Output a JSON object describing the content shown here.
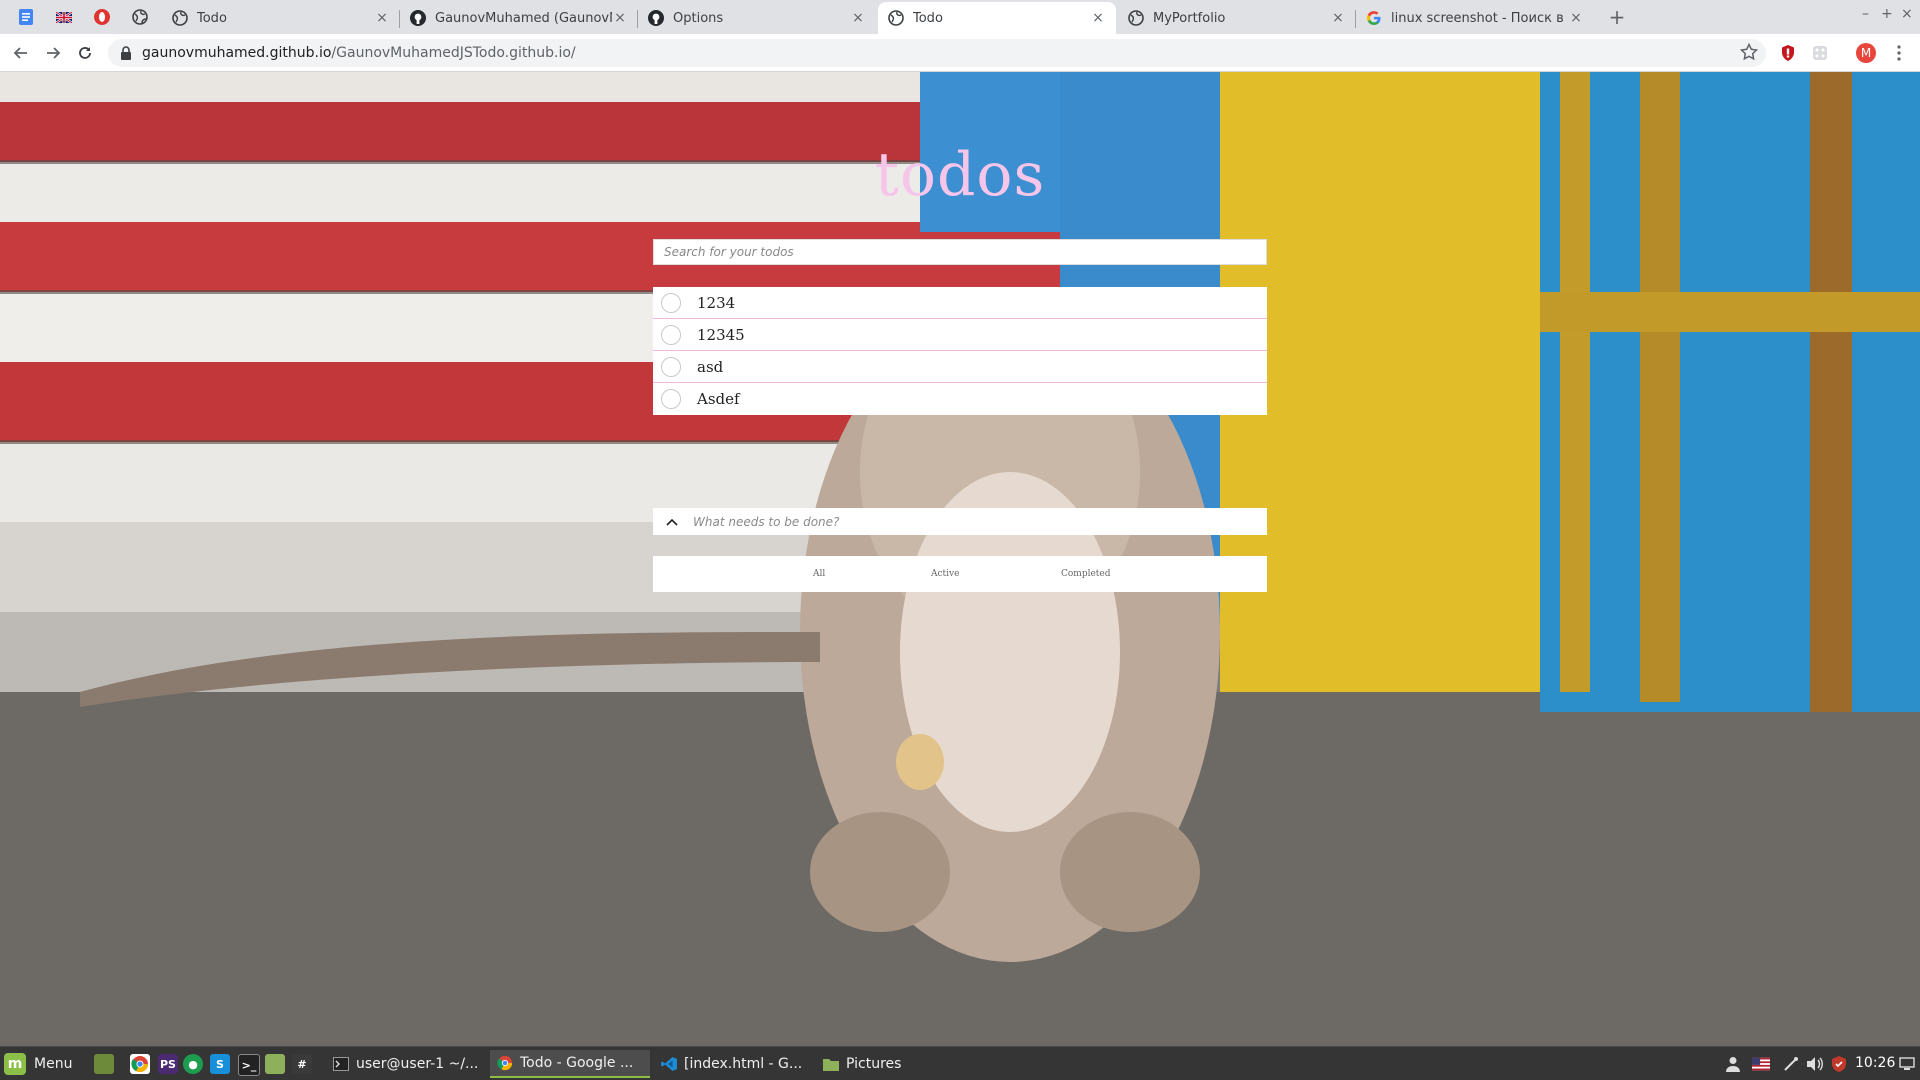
{
  "browser": {
    "tabs": [
      {
        "title": "Todo",
        "icon": "globe-icon",
        "active": false
      },
      {
        "title": "GaunovMuhamed (GaunovMuh",
        "icon": "github-icon",
        "active": false
      },
      {
        "title": "Options",
        "icon": "github-icon",
        "active": false
      },
      {
        "title": "Todo",
        "icon": "globe-icon",
        "active": true
      },
      {
        "title": "MyPortfolio",
        "icon": "globe-icon",
        "active": false
      },
      {
        "title": "linux screenshot - Поиск в Goo",
        "icon": "google-icon",
        "active": false
      }
    ],
    "pinned_tabs": [
      "docs-icon",
      "uk-flag-icon",
      "opera-icon",
      "globe-icon"
    ],
    "new_tab_label": "+",
    "close_label": "×",
    "url_host": "gaunovmuhamed.github.io",
    "url_path": "/GaunovMuhamedJSTodo.github.io/",
    "profile_initial": "M",
    "window_controls": [
      "–",
      "+",
      "×"
    ]
  },
  "app": {
    "title": "todos",
    "search_placeholder": "Search for your todos",
    "todos": [
      {
        "text": "1234",
        "completed": false
      },
      {
        "text": "12345",
        "completed": false
      },
      {
        "text": "asd",
        "completed": false
      },
      {
        "text": "Asdef",
        "completed": false
      }
    ],
    "new_todo_placeholder": "What needs to be done?",
    "filters": {
      "all": "All",
      "active": "Active",
      "completed": "Completed"
    }
  },
  "taskbar": {
    "menu_label": "Menu",
    "windows": [
      {
        "title": "user@user-1 ~/...",
        "icon": "terminal-icon",
        "active": false
      },
      {
        "title": "Todo - Google ...",
        "icon": "chrome-icon",
        "active": true
      },
      {
        "title": "[index.html - G...",
        "icon": "vscode-icon",
        "active": false
      },
      {
        "title": "Pictures",
        "icon": "folder-icon",
        "active": false
      }
    ],
    "clock": "10:26"
  },
  "colors": {
    "title_pink": "#f5c6e9",
    "divider_pink": "#f0b5e0",
    "mint_green": "#8bbf47",
    "profile_red": "#e8453c"
  }
}
